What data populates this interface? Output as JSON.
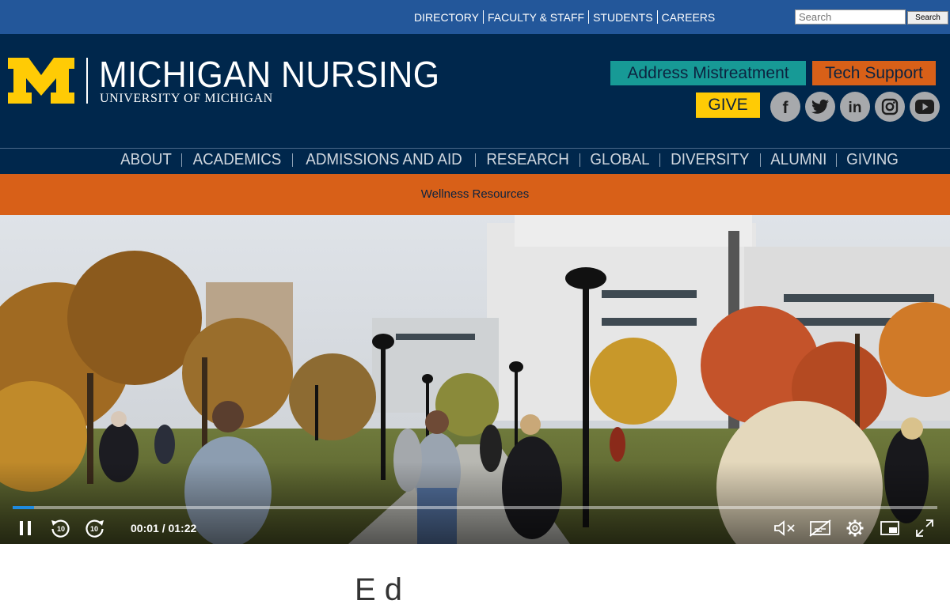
{
  "utility_nav": {
    "links": [
      "DIRECTORY",
      "FACULTY & STAFF",
      "STUDENTS",
      "CAREERS"
    ],
    "search_placeholder": "Search",
    "search_button": "Search"
  },
  "header": {
    "logo_title": "MICHIGAN NURSING",
    "logo_subtitle": "UNIVERSITY OF MICHIGAN",
    "btn_mistreatment": "Address Mistreatment",
    "btn_tech_support": "Tech Support",
    "btn_give": "GIVE",
    "social_icons": [
      "facebook-icon",
      "twitter-icon",
      "linkedin-icon",
      "instagram-icon",
      "youtube-icon"
    ]
  },
  "main_nav": [
    "ABOUT",
    "ACADEMICS",
    "ADMISSIONS AND AID",
    "RESEARCH",
    "GLOBAL",
    "DIVERSITY",
    "ALUMNI",
    "GIVING"
  ],
  "wellness": {
    "label": "Wellness Resources"
  },
  "video": {
    "time_display": "00:01 / 01:22",
    "progress": 0.023,
    "controls": [
      "pause-icon",
      "rewind-10-icon",
      "forward-10-icon",
      "mute-icon",
      "captions-off-icon",
      "settings-icon",
      "picture-in-picture-icon",
      "fullscreen-icon"
    ]
  },
  "content": {
    "heading_partial": "E d"
  },
  "colors": {
    "utility_blue": "#23579a",
    "navy": "#00274c",
    "maize": "#ffcb05",
    "teal": "#179a96",
    "orange": "#d86018",
    "social_grey": "#a7a9ac"
  }
}
